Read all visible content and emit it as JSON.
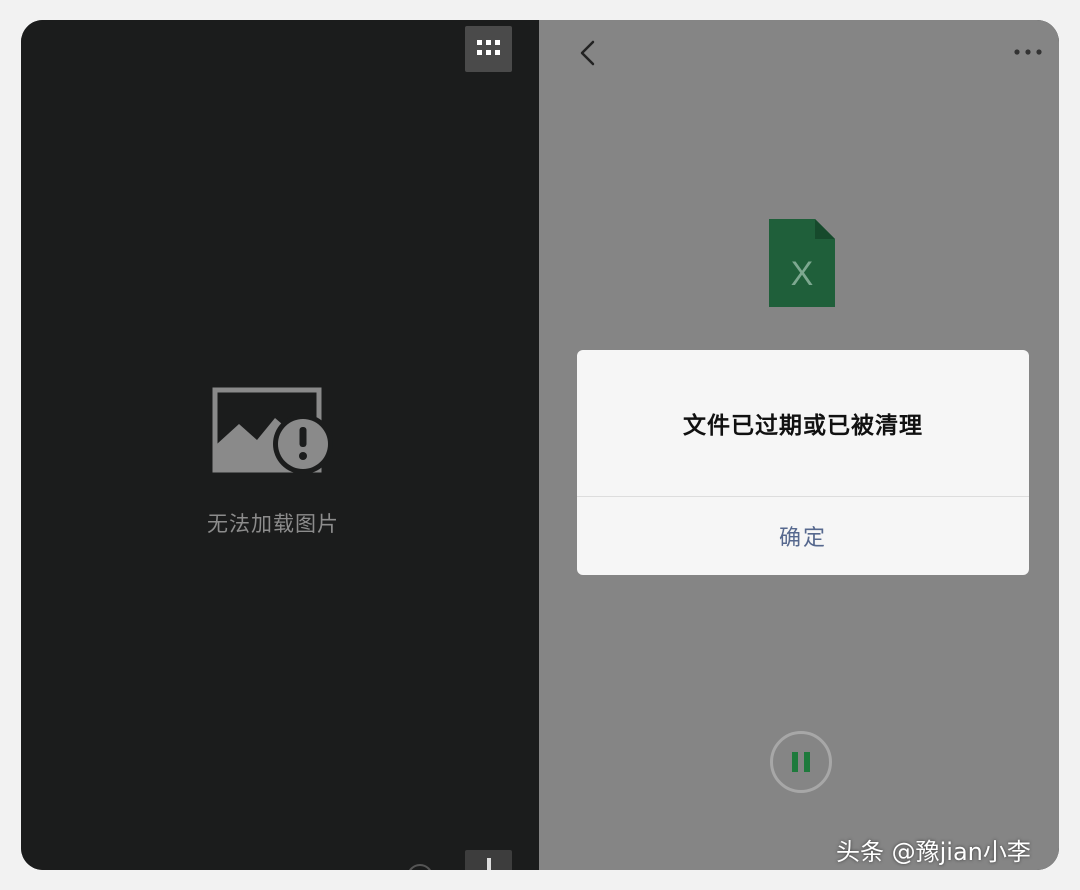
{
  "left": {
    "grid_icon": "grid-icon",
    "image_error_icon": "image-error-icon",
    "image_error_label": "无法加载图片",
    "bottom_plus_icon": "plus-icon"
  },
  "right": {
    "back_icon": "chevron-left-icon",
    "more_icon": "more-icon",
    "file_icon": "excel-file-icon",
    "file_icon_letter": "X",
    "dialog": {
      "message": "文件已过期或已被清理",
      "ok_label": "确定"
    },
    "pause_icon": "pause-icon"
  },
  "watermark": "头条 @豫jian小李",
  "colors": {
    "left_bg": "#1b1c1c",
    "right_bg": "#858585",
    "excel_green": "#1f5f3a",
    "dialog_ok": "#56688e",
    "pause_green": "#1e7a3c"
  }
}
